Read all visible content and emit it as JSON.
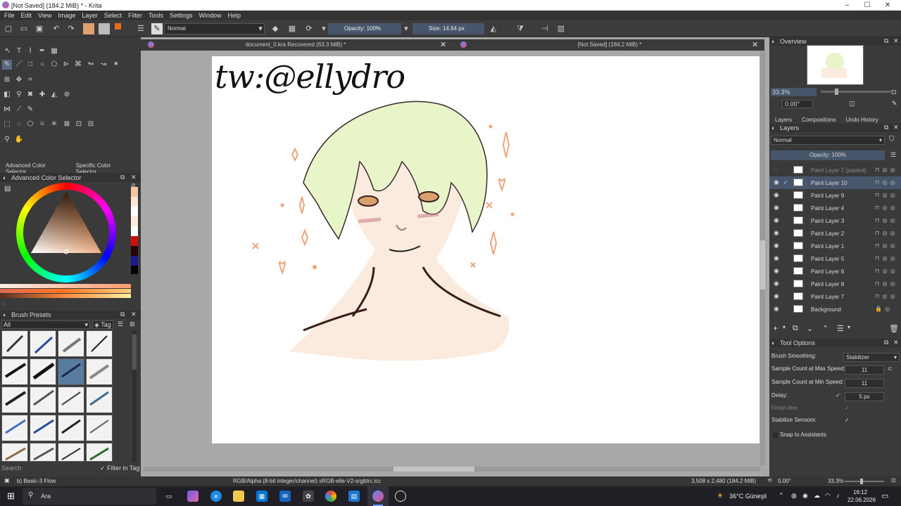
{
  "window": {
    "title": "[Not Saved]  (184.2 MiB) * - Krita"
  },
  "menu": [
    "File",
    "Edit",
    "View",
    "Image",
    "Layer",
    "Select",
    "Filter",
    "Tools",
    "Settings",
    "Window",
    "Help"
  ],
  "toolbar": {
    "blend_mode": "Normal",
    "opacity": "Opacity: 100%",
    "size": "Size: 14.64 px"
  },
  "tabs": [
    {
      "label": "document_0.kra Recovered (63.3 MiB) *"
    },
    {
      "label": "[Not Saved]  (184.2 MiB) *"
    }
  ],
  "canvas": {
    "signature": "tw:@ellydro"
  },
  "left_panels": {
    "color_tabs": [
      "Advanced Color Selector",
      "Specific Color Selector"
    ],
    "color_title": "Advanced Color Selector",
    "brush_title": "Brush Presets",
    "brush_filter": "All",
    "tag_label": "Tag",
    "search_placeholder": "Search",
    "filter_in_tag": "Filter in Tag",
    "current_brush": "b) Basic-3 Flow"
  },
  "overview": {
    "title": "Overview",
    "zoom": "33.3%",
    "rotation": "0.00°"
  },
  "layers_panel": {
    "tabs": [
      "Layers",
      "Compositions",
      "Undo History"
    ],
    "title": "Layers",
    "blend": "Normal",
    "opacity": "Opacity:  100%",
    "layers": [
      {
        "name": "Paint Layer 2 (pasted)",
        "active": false,
        "dim": true
      },
      {
        "name": "Paint Layer 10",
        "active": true,
        "dim": false
      },
      {
        "name": "Paint Layer 9",
        "active": false,
        "dim": false
      },
      {
        "name": "Paint Layer 4",
        "active": false,
        "dim": false
      },
      {
        "name": "Paint Layer 3",
        "active": false,
        "dim": false
      },
      {
        "name": "Paint Layer 2",
        "active": false,
        "dim": false
      },
      {
        "name": "Paint Layer 1",
        "active": false,
        "dim": false
      },
      {
        "name": "Paint Layer 5",
        "active": false,
        "dim": false
      },
      {
        "name": "Paint Layer 6",
        "active": false,
        "dim": false
      },
      {
        "name": "Paint Layer 8",
        "active": false,
        "dim": false
      },
      {
        "name": "Paint Layer 7",
        "active": false,
        "dim": false
      },
      {
        "name": "Background",
        "active": false,
        "dim": false
      }
    ]
  },
  "tool_options": {
    "title": "Tool Options",
    "brush_smoothing_label": "Brush Smoothing:",
    "brush_smoothing_value": "Stabilizer",
    "max_speed_label": "Sample Count at Max Speed:",
    "max_speed_value": "11",
    "min_speed_label": "Sample Count at Min Speed:",
    "min_speed_value": "11",
    "delay_label": "Delay:",
    "delay_value": "5 px",
    "finish_line_label": "Finish line:",
    "stabilize_sensors_label": "Stabilize Sensors:",
    "snap_label": "Snap to Assistants"
  },
  "status": {
    "color_profile": "RGB/Alpha (8-bit integer/channel)  sRGB-elle-V2-srgbtrc.icc",
    "dimensions": "3,508 x 2,480 (184.2 MiB)",
    "rotation": "0.00°",
    "zoom": "33.3%"
  },
  "taskbar": {
    "search_placeholder": "Ara",
    "weather": "36°C  Güneşli",
    "time": "16:12",
    "date": "22.06.2026"
  },
  "colors": {
    "accent": "#47566a",
    "ui_bg": "#3a3a3a",
    "canvas_bg": "#a8a8a8",
    "skin": "#fbeade",
    "hair": "#e8f5c8",
    "sparkle": "#f0a47c"
  }
}
